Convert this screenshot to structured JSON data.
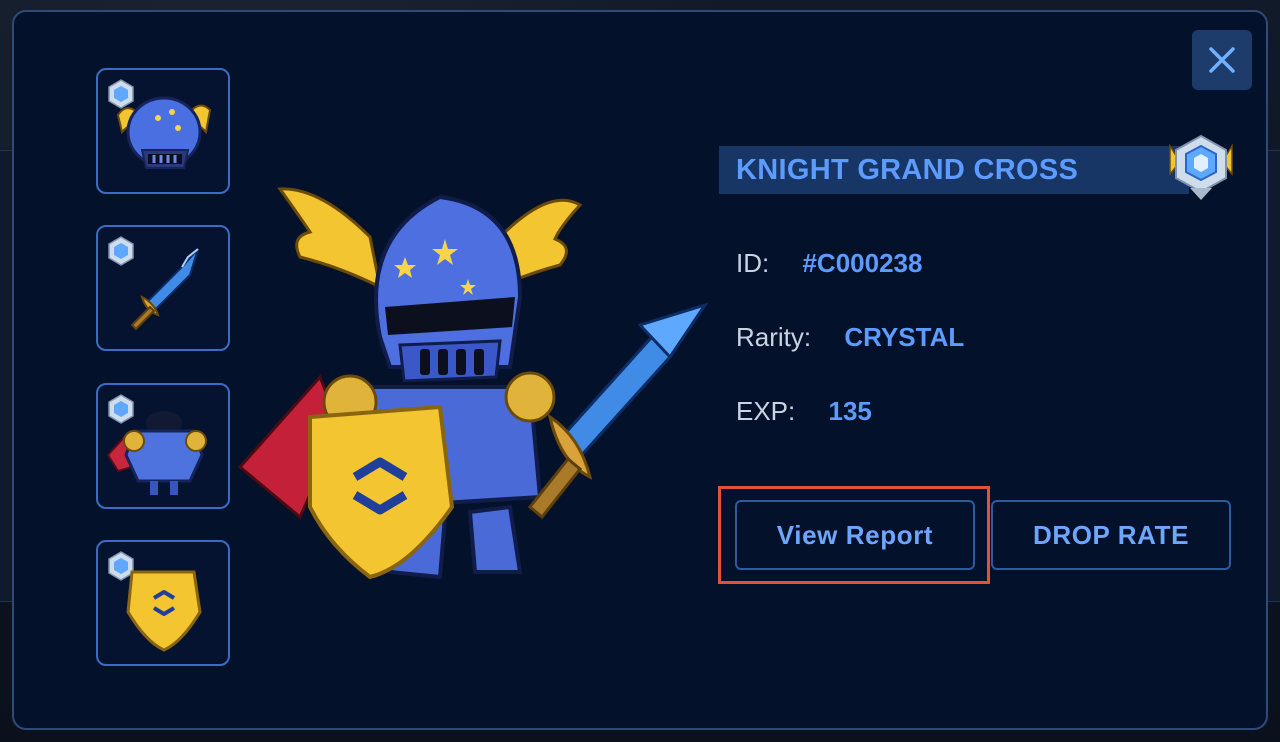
{
  "modal": {
    "close_icon": "close-icon",
    "slots": [
      {
        "name": "helmet",
        "icon": "winged-helmet-icon",
        "badge": "crystal-rank-badge-icon"
      },
      {
        "name": "sword",
        "icon": "sword-icon",
        "badge": "crystal-rank-badge-icon"
      },
      {
        "name": "armor",
        "icon": "armor-icon",
        "badge": "crystal-rank-badge-icon"
      },
      {
        "name": "shield",
        "icon": "shield-icon",
        "badge": "crystal-rank-badge-icon"
      }
    ],
    "character_icon": "knight-character-icon",
    "title": "KNIGHT GRAND CROSS",
    "title_badge": "crystal-rank-badge-icon",
    "info": {
      "id_label": "ID:",
      "id_value": "#C000238",
      "rarity_label": "Rarity:",
      "rarity_value": "CRYSTAL",
      "exp_label": "EXP:",
      "exp_value": "135"
    },
    "buttons": {
      "view_report": "View Report",
      "drop_rate": "DROP RATE"
    }
  },
  "colors": {
    "background": "#04112a",
    "accent": "#5c9bff",
    "border": "#3a6cc7",
    "highlight": "#e0533a",
    "gold": "#f2c531"
  }
}
